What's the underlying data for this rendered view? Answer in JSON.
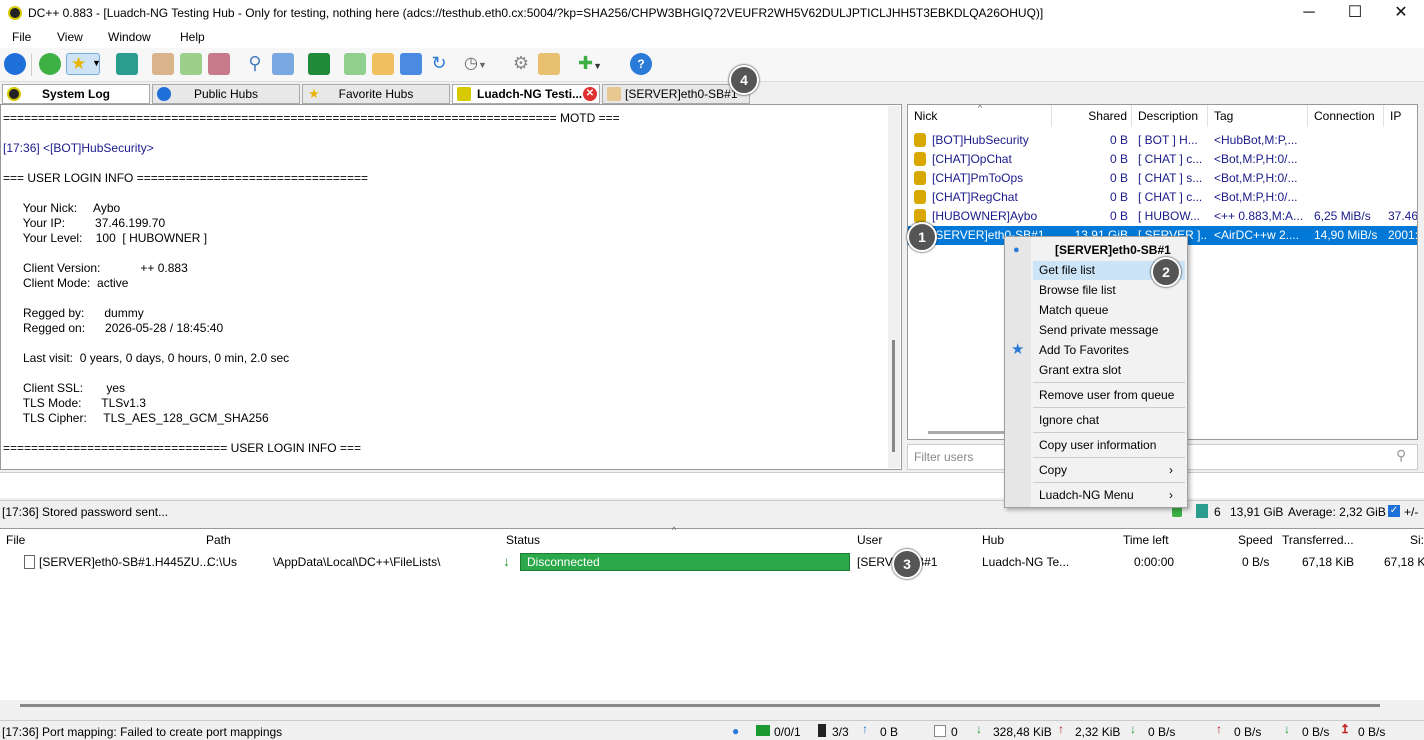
{
  "window": {
    "title": "DC++ 0.883 - [Luadch-NG Testing Hub - Only for testing, nothing here (adcs://testhub.eth0.cx:5004/?kp=SHA256/CHPW3BHGIQ72VEUFR2WH5V62DULJPTICLJHH5T3EBKDLQA26OHUQ)]",
    "minimize": "─",
    "maximize": "☐",
    "close": "✕"
  },
  "menu": [
    "File",
    "View",
    "Window",
    "Help"
  ],
  "tabs": [
    {
      "label": "System Log",
      "active": true
    },
    {
      "label": "Public Hubs"
    },
    {
      "label": "Favorite Hubs"
    },
    {
      "label": "Luadch-NG Testi..."
    },
    {
      "label": "[SERVER]eth0-SB#1"
    }
  ],
  "chat": {
    "lines": [
      "=============================================================================== MOTD ===",
      "",
      "[17:36] <[BOT]HubSecurity>",
      "",
      "=== USER LOGIN INFO =================================",
      "",
      "      Your Nick:     Aybo",
      "      Your IP:         37.46.199.70",
      "      Your Level:    100  [ HUBOWNER ]",
      "",
      "      Client Version:            ++ 0.883",
      "      Client Mode:  active",
      "",
      "      Regged by:      dummy",
      "      Regged on:      2026-05-28 / 18:45:40",
      "",
      "      Last visit:  0 years, 0 days, 0 hours, 0 min, 2.0 sec",
      "",
      "      Client SSL:       yes",
      "      TLS Mode:      TLSv1.3",
      "      TLS Cipher:     TLS_AES_128_GCM_SHA256",
      "",
      "================================ USER LOGIN INFO ==="
    ]
  },
  "userlist": {
    "headers": [
      "Nick",
      "Shared",
      "Description",
      "Tag",
      "Connection",
      "IP"
    ],
    "rows": [
      {
        "nick": "[BOT]HubSecurity",
        "shared": "0 B",
        "desc": "[ BOT ] H...",
        "tag": "<HubBot,M:P,...",
        "conn": "",
        "ip": ""
      },
      {
        "nick": "[CHAT]OpChat",
        "shared": "0 B",
        "desc": "[ CHAT ] c...",
        "tag": "<Bot,M:P,H:0/...",
        "conn": "",
        "ip": ""
      },
      {
        "nick": "[CHAT]PmToOps",
        "shared": "0 B",
        "desc": "[ CHAT ] s...",
        "tag": "<Bot,M:P,H:0/...",
        "conn": "",
        "ip": ""
      },
      {
        "nick": "[CHAT]RegChat",
        "shared": "0 B",
        "desc": "[ CHAT ] c...",
        "tag": "<Bot,M:P,H:0/...",
        "conn": "",
        "ip": ""
      },
      {
        "nick": "[HUBOWNER]Aybo",
        "shared": "0 B",
        "desc": "[ HUBOW...",
        "tag": "<++ 0.883,M:A...",
        "conn": "6,25 MiB/s",
        "ip": "37.46"
      },
      {
        "nick": "[SERVER]eth0-SB#1",
        "shared": "13,91 GiB",
        "desc": "[ SERVER ]...",
        "tag": "<AirDC++w 2....",
        "conn": "14,90 MiB/s",
        "ip": "2001:"
      }
    ],
    "filter_placeholder": "Filter users"
  },
  "context_menu": {
    "header": "[SERVER]eth0-SB#1",
    "items": [
      "Get file list",
      "Browse file list",
      "Match queue",
      "Send private message",
      "Add To Favorites",
      "Grant extra slot",
      "Remove user from queue",
      "Ignore chat",
      "Copy user information",
      "Copy",
      "Luadch-NG Menu"
    ]
  },
  "status_mid": {
    "message": "[17:36] Stored password sent...",
    "users": "6",
    "share": "13,91 GiB",
    "average": "Average: 2,32 GiB",
    "plusminus": "+/-"
  },
  "queue": {
    "headers": [
      "File",
      "Path",
      "Status",
      "User",
      "Hub",
      "Time left",
      "Speed",
      "Transferred...",
      "Si:"
    ],
    "row": {
      "file": "[SERVER]eth0-SB#1.H445ZU...",
      "path": "C:\\Us   \\AppData\\Local\\DC++\\FileLists\\",
      "status": "Disconnected",
      "user": "[SERVE  -SB#1",
      "hub": "Luadch-NG Te...",
      "time": "0:00:00",
      "speed": "0 B/s",
      "transferred": "67,18 KiB",
      "size": "67,18 K"
    }
  },
  "status_bottom": {
    "message": "[17:36] Port mapping: Failed to create port mappings",
    "hubs": "0/0/1",
    "slots": "3/3",
    "up_queue": "0 B",
    "zero": "0",
    "down_total": "328,48 KiB",
    "up_total": "2,32 KiB",
    "down_speed": "0 B/s",
    "up_speed": "0 B/s",
    "down_limit": "0 B/s",
    "up_limit": "0 B/s"
  },
  "badges": [
    "1",
    "2",
    "3",
    "4"
  ]
}
